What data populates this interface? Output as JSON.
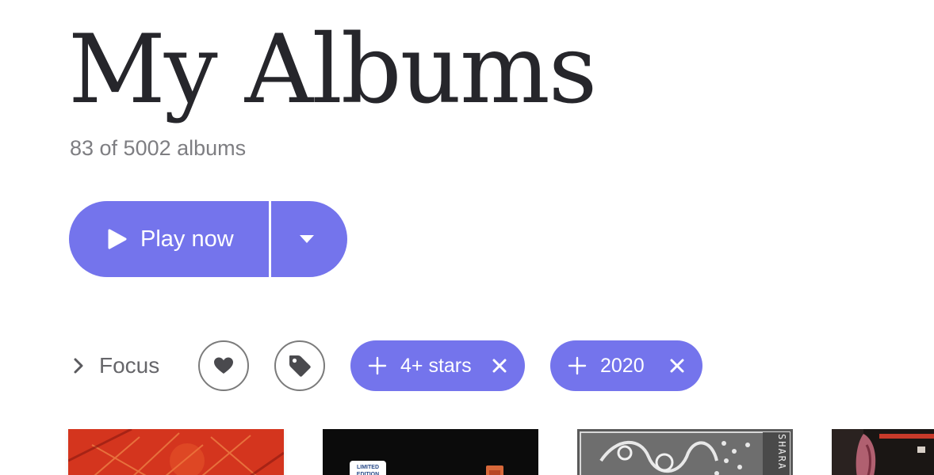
{
  "header": {
    "title": "My Albums",
    "count_text": "83 of 5002 albums"
  },
  "play": {
    "label": "Play now",
    "play_icon": "play-icon",
    "menu_icon": "caret-down-icon"
  },
  "filters": {
    "focus_label": "Focus",
    "focus_icon": "chevron-right-icon",
    "favorite_icon": "heart-icon",
    "tag_icon": "tag-icon",
    "chips": [
      {
        "label": "4+ stars",
        "add_icon": "plus-icon",
        "remove_icon": "close-icon"
      },
      {
        "label": "2020",
        "add_icon": "plus-icon",
        "remove_icon": "close-icon"
      }
    ]
  },
  "albums": {
    "cover_badge": "LIMITED EDITION",
    "cover_text_3": "SHARA"
  },
  "colors": {
    "accent": "#7474ec",
    "title": "#26262b",
    "subtitle": "#7e7e82",
    "outline": "#7b7b7b"
  }
}
